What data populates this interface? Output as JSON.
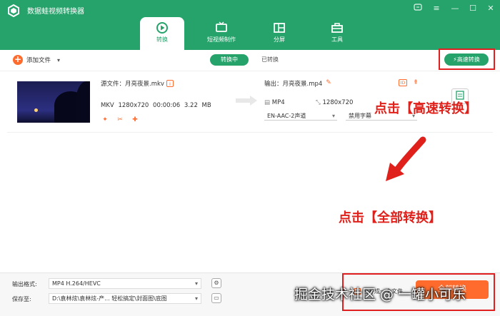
{
  "window": {
    "title": "数据蛙视频转换器",
    "controls": [
      "menu-icon",
      "more-icon",
      "minimize-icon",
      "maximize-icon",
      "close-icon"
    ]
  },
  "tabs": [
    {
      "label": "转换",
      "icon": "convert-icon",
      "active": true
    },
    {
      "label": "短视频制作",
      "icon": "tv-icon",
      "active": false
    },
    {
      "label": "分屏",
      "icon": "split-screen-icon",
      "active": false
    },
    {
      "label": "工具",
      "icon": "toolbox-icon",
      "active": false
    }
  ],
  "toolbar": {
    "add_file": "添加文件",
    "converting": "转换中",
    "converted": "已转换",
    "fast_convert": "高速转换"
  },
  "file": {
    "source_label": "源文件：月亮夜景.mkv",
    "format": "MKV",
    "resolution": "1280x720",
    "duration": "00:00:06",
    "size": "3.22 MB",
    "output_label": "输出：月亮夜景.mp4",
    "out_format": "MP4",
    "out_resolution": "1280x720",
    "audio_track": "EN-AAC-2声道",
    "subtitle": "禁用字幕"
  },
  "annotations": {
    "top": "点击【高速转换】",
    "bottom": "点击【全部转换】"
  },
  "bottom": {
    "format_label": "输出格式:",
    "format_value": "MP4 H.264/HEVC",
    "save_label": "保存至:",
    "save_value": "D:\\袁林炫\\袁林炫-产...  轻松搞定\\封面图\\底图",
    "merge": "合并成一个文件",
    "convert_all": "全部转换"
  },
  "watermark": "掘金技术社区 @ 一罐小可乐",
  "colors": {
    "accent": "#25a36b",
    "orange": "#ff6b2c",
    "highlight": "#e02020"
  }
}
